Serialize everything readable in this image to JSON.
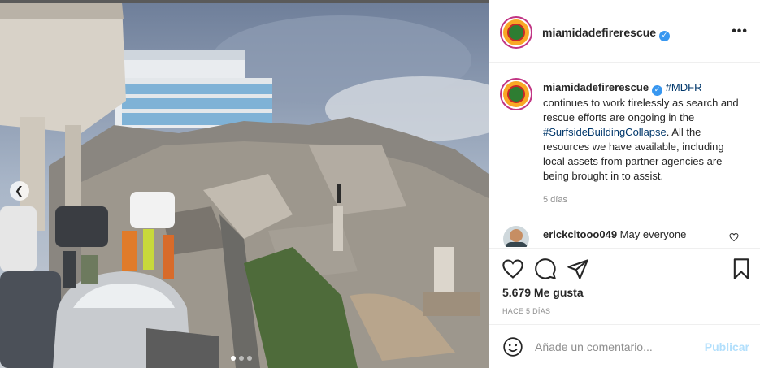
{
  "post": {
    "username": "miamidadefirerescue",
    "more_icon": "more-options-icon",
    "caption_tag_1": "#MDFR",
    "caption_body_1": " continues to work tirelessly as search and rescue efforts are ongoing in the ",
    "caption_tag_2": "#SurfsideBuildingCollapse",
    "caption_body_2": ". All the resources we have available, including local assets from partner agencies are being brought in to assist.",
    "caption_time": "5 días",
    "comment": {
      "username": "erickcitooo049",
      "text": "May everyone"
    },
    "likes": "5.679 Me gusta",
    "posted_ago": "HACE 5 DÍAS",
    "comment_placeholder": "Añade un comentario...",
    "publish_label": "Publicar",
    "carousel": {
      "total": 3,
      "active_index": 0
    }
  },
  "colors": {
    "verified": "#3897f0",
    "publish_disabled": "#b2dffc",
    "tag_link": "#00376b",
    "avatar_ring": "#c13584"
  }
}
